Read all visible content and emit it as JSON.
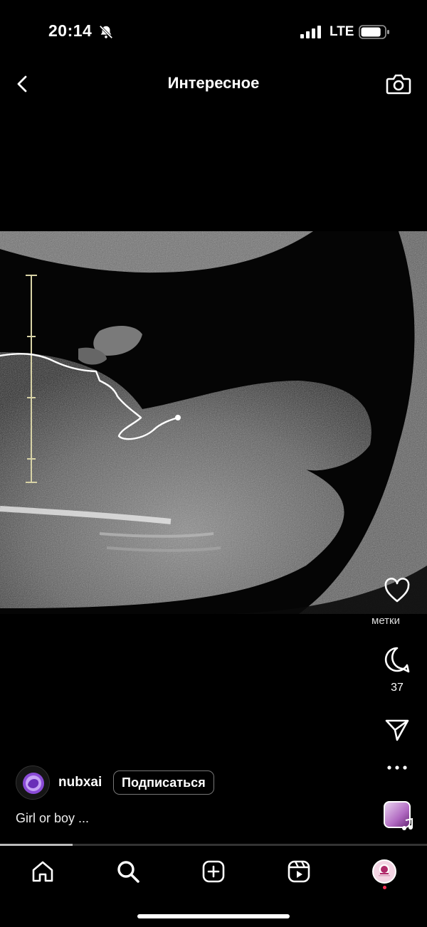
{
  "status_bar": {
    "time": "20:14",
    "network": "LTE",
    "signal_bars": 4,
    "battery_level": 0.85
  },
  "header": {
    "title": "Интересное"
  },
  "post": {
    "likes_label": "метки",
    "comment_count": "37",
    "author": "nubxai",
    "follow_label": "Подписаться",
    "caption": "Girl or boy ...",
    "progress": 0.17
  },
  "icons": {
    "back": "chevron-left-icon",
    "camera": "camera-icon",
    "like": "heart-icon",
    "comment": "comment-bubble-icon",
    "share": "paper-plane-icon",
    "more": "more-dots-icon",
    "music": "music-note-icon",
    "tabs": [
      "home-icon",
      "search-icon",
      "add-icon",
      "reels-icon",
      "profile-avatar"
    ]
  },
  "colors": {
    "background": "#000000",
    "text": "#ffffff",
    "notification_dot": "#ff2d55"
  }
}
